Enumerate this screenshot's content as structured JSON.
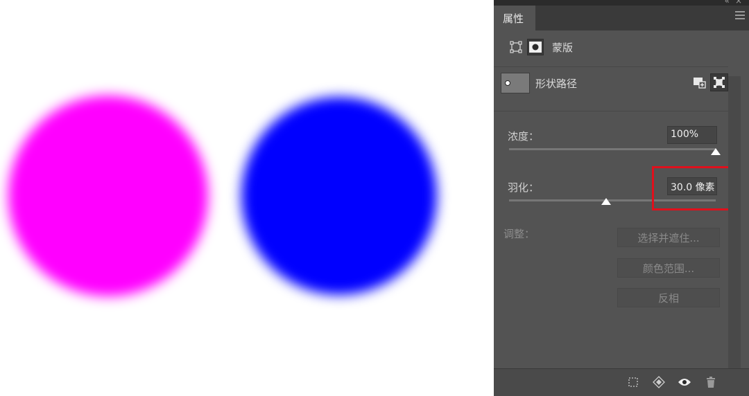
{
  "panel": {
    "tab_label": "属性",
    "mode_label": "蒙版",
    "path_label": "形状路径",
    "density_label": "浓度：",
    "density_value": "100%",
    "density_level": 1.0,
    "feather_label": "羽化：",
    "feather_value": "30.0 像素",
    "feather_level": 0.47,
    "adjust_label": "调整：",
    "buttons": {
      "select_and_mask": "选择并遮住...",
      "color_range": "颜色范围...",
      "invert": "反相"
    }
  },
  "colors": {
    "magenta_shape": "#ff00ff",
    "blue_shape": "#0000ff",
    "highlight_box": "#e0101c",
    "panel_bg": "#535353"
  },
  "icons": {
    "collapse": "double-chevron-icon",
    "close": "close-icon",
    "menu": "panel-menu-icon",
    "pixel_mask": "pixel-mask-icon",
    "vector_mask": "vector-mask-icon",
    "add_mask": "add-mask-icon",
    "select_mask": "select-mask-icon",
    "load_selection": "load-selection-icon",
    "apply_mask": "apply-mask-icon",
    "visibility": "eye-icon",
    "delete": "trash-icon"
  }
}
